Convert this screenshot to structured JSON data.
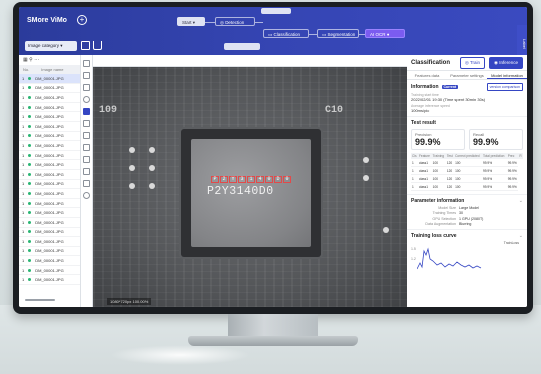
{
  "app": {
    "title": "SMore ViMo",
    "image_category": "Image category",
    "flow_start": "Start",
    "flow_nodes": [
      "Detection",
      "Classification",
      "Segmentation",
      "AI OCR"
    ],
    "right_tab_label": "Label"
  },
  "left_list": {
    "headers": [
      "No.",
      "Image name"
    ],
    "rows": [
      {
        "no": "1",
        "name": "DM_00001.JPG",
        "selected": true
      },
      {
        "no": "1",
        "name": "DM_00001.JPG"
      },
      {
        "no": "1",
        "name": "DM_00001.JPG"
      },
      {
        "no": "1",
        "name": "DM_00001.JPG"
      },
      {
        "no": "1",
        "name": "DM_00001.JPG"
      },
      {
        "no": "1",
        "name": "DM_00001.JPG"
      },
      {
        "no": "1",
        "name": "DM_00001.JPG"
      },
      {
        "no": "1",
        "name": "DM_00001.JPG"
      },
      {
        "no": "1",
        "name": "DM_00001.JPG"
      },
      {
        "no": "1",
        "name": "DM_00001.JPG"
      },
      {
        "no": "1",
        "name": "DM_00001.JPG"
      },
      {
        "no": "1",
        "name": "DM_00001.JPG"
      },
      {
        "no": "1",
        "name": "DM_00001.JPG"
      },
      {
        "no": "1",
        "name": "DM_00001.JPG"
      },
      {
        "no": "1",
        "name": "DM_00001.JPG"
      },
      {
        "no": "1",
        "name": "DM_00001.JPG"
      },
      {
        "no": "1",
        "name": "DM_00001.JPG"
      },
      {
        "no": "1",
        "name": "DM_00001.JPG"
      },
      {
        "no": "1",
        "name": "DM_00001.JPG"
      },
      {
        "no": "1",
        "name": "DM_00001.JPG"
      },
      {
        "no": "1",
        "name": "DM_00001.JPG"
      },
      {
        "no": "1",
        "name": "DM_00001.JPG"
      }
    ]
  },
  "viewport": {
    "board_label_left": "109",
    "board_label_right": "C10",
    "chip_code": "P2Y3140D0",
    "chip_small_chars": [
      "P",
      "2",
      "Y",
      "3",
      "1",
      "4",
      "0",
      "D",
      "0"
    ],
    "dimension_readout": "1080*720px 100.00%"
  },
  "right_panel": {
    "title": "Classification",
    "train_label": "Train",
    "inference_label": "Inference",
    "tabs": [
      "Features data",
      "Parameter settings",
      "Model information"
    ],
    "information": {
      "title": "Information",
      "badge": "Current",
      "compare_label": "version comparison",
      "training_start_label": "Training start time",
      "training_start_value": "2022/02/01 19:30 (Time spent 30min 30s)",
      "avg_inference_label": "Average inference speed",
      "avg_inference_value": "100ms/pic"
    },
    "test_result": {
      "title": "Test result",
      "precision_label": "Precision",
      "precision_value": "99.9%",
      "recall_label": "Recall",
      "recall_value": "99.9%",
      "table_headers": [
        "Cls",
        "Feature",
        "Training",
        "Test",
        "Correct predicted",
        "Total prediction",
        "Prec",
        "R"
      ],
      "rows": [
        [
          "1",
          "class1",
          "100",
          "120",
          "100",
          "99.9%",
          "99.9%"
        ],
        [
          "1",
          "class1",
          "100",
          "120",
          "100",
          "99.9%",
          "99.9%"
        ],
        [
          "1",
          "class1",
          "100",
          "120",
          "100",
          "99.9%",
          "99.9%"
        ],
        [
          "1",
          "class1",
          "100",
          "120",
          "100",
          "99.9%",
          "99.9%"
        ]
      ]
    },
    "parameters": {
      "title": "Parameter information",
      "items": [
        {
          "k": "Model Size",
          "v": "Large Model"
        },
        {
          "k": "Training Times",
          "v": "30"
        },
        {
          "k": "GPU Selection",
          "v": "1 GPU (2080T)"
        },
        {
          "k": "Data Augmentation",
          "v": "Blurring"
        }
      ]
    },
    "curve": {
      "title": "Training loss curve",
      "legend": "TrainLoss",
      "y_ticks": [
        "1.5",
        "1.2"
      ]
    }
  },
  "colors": {
    "header_blue": "#3545b3",
    "accent": "#3546c3",
    "active_node": "#7b5cf0",
    "status_green": "#2bb673"
  }
}
